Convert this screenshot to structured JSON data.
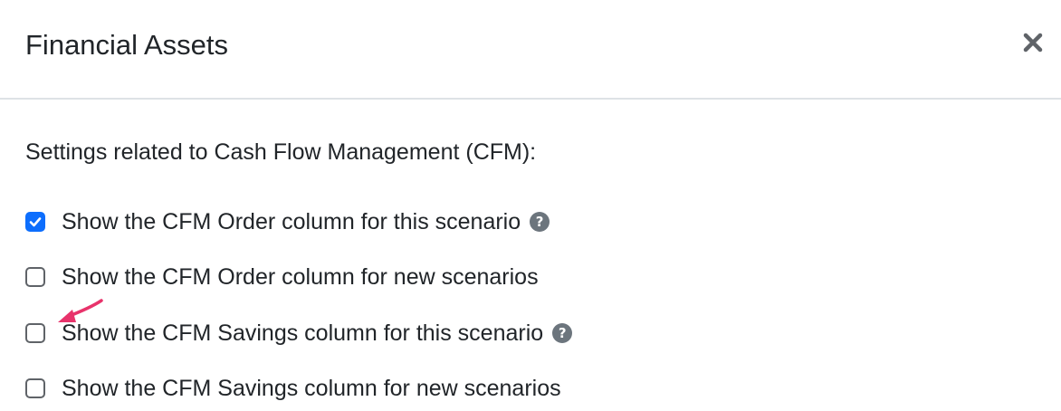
{
  "modal": {
    "title": "Financial Assets",
    "close_icon": "close-icon",
    "intro_text": "Settings related to Cash Flow Management (CFM):",
    "options": [
      {
        "label": "Show the CFM Order column for this scenario",
        "checked": true,
        "help": true
      },
      {
        "label": "Show the CFM Order column for new scenarios",
        "checked": false,
        "help": false
      },
      {
        "label": "Show the CFM Savings column for this scenario",
        "checked": false,
        "help": true
      },
      {
        "label": "Show the CFM Savings column for new scenarios",
        "checked": false,
        "help": false
      }
    ]
  },
  "colors": {
    "checkbox_checked": "#0d6efd",
    "help_icon": "#6c757d",
    "annotation_arrow": "#e8336b"
  },
  "help_icon_glyph": "?"
}
